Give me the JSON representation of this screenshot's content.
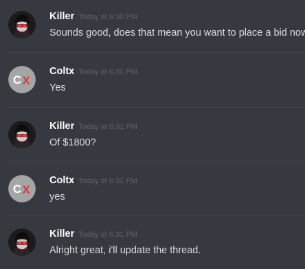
{
  "messages": [
    {
      "author": "Killer",
      "time": "Today at 6:30 PM",
      "text": "Sounds good, does that mean you want to place a bid now?",
      "avatar": "killer-avatar"
    },
    {
      "author": "Coltx",
      "time": "Today at 6:31 PM",
      "text": "Yes",
      "avatar": "coltx-avatar"
    },
    {
      "author": "Killer",
      "time": "Today at 6:31 PM",
      "text": "Of $1800?",
      "avatar": "killer-avatar"
    },
    {
      "author": "Coltx",
      "time": "Today at 6:31 PM",
      "text": "yes",
      "avatar": "coltx-avatar"
    },
    {
      "author": "Killer",
      "time": "Today at 6:31 PM",
      "text": "Alright great, i'll update the thread.",
      "avatar": "killer-avatar"
    }
  ],
  "coltx_avatar": {
    "letter_c": "C",
    "letter_x": "X"
  },
  "colors": {
    "background": "#36393f",
    "divider": "#42454a",
    "username": "#ffffff",
    "timestamp": "#5f6269",
    "message_text": "#dcddde",
    "coltx_avatar_bg": "#a5a5a5",
    "coltx_x": "#d63a3a"
  }
}
